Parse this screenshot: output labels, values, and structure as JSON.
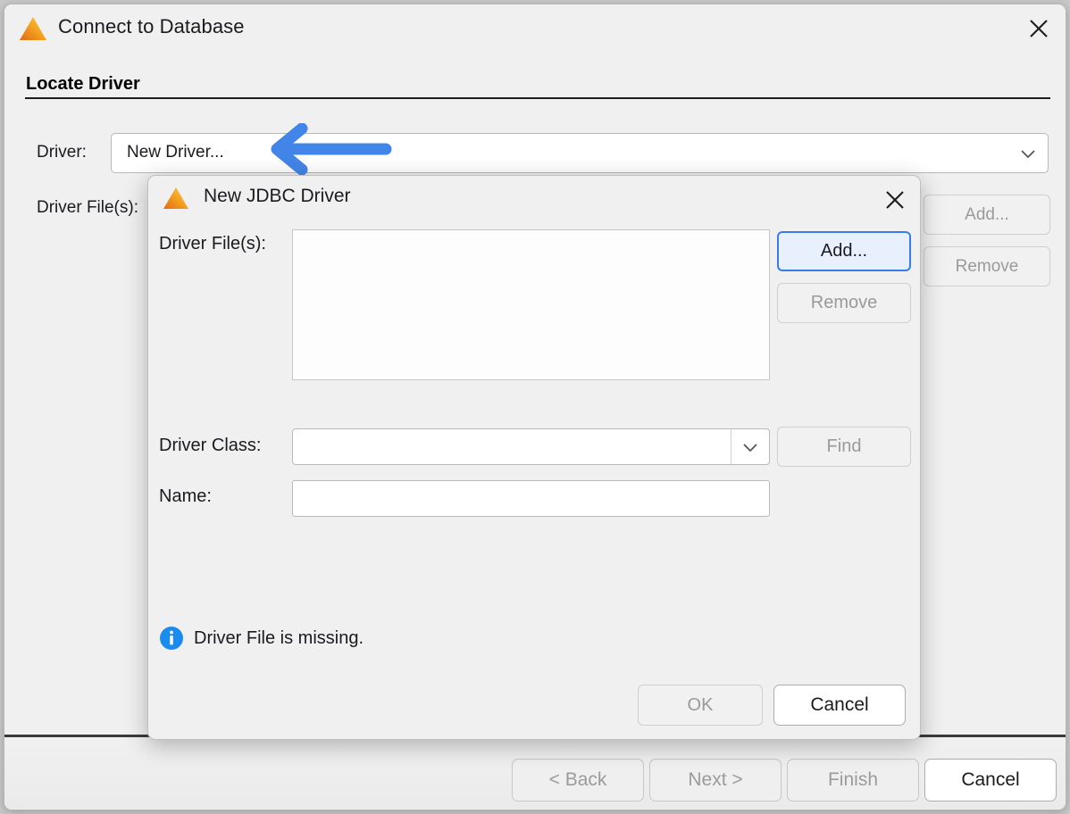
{
  "outer_dialog": {
    "title": "Connect to Database",
    "app_icon": "triangle-logo-icon",
    "close_icon": "close-icon",
    "section_heading": "Locate Driver",
    "driver": {
      "label": "Driver:",
      "value": "New Driver...",
      "dropdown_icon": "chevron-down-icon"
    },
    "driver_files": {
      "label": "Driver File(s):",
      "items": [],
      "add_label": "Add...",
      "remove_label": "Remove"
    },
    "footer": {
      "back_label": "< Back",
      "next_label": "Next >",
      "finish_label": "Finish",
      "cancel_label": "Cancel"
    }
  },
  "annotation": {
    "type": "arrow-left",
    "color": "#4285e8"
  },
  "inner_dialog": {
    "title": "New JDBC Driver",
    "app_icon": "triangle-logo-icon",
    "close_icon": "close-icon",
    "driver_files": {
      "label": "Driver File(s):",
      "items": [],
      "add_label": "Add...",
      "remove_label": "Remove"
    },
    "driver_class": {
      "label": "Driver Class:",
      "value": "",
      "placeholder": "",
      "dropdown_icon": "chevron-down-icon",
      "find_label": "Find"
    },
    "name": {
      "label": "Name:",
      "value": "",
      "placeholder": ""
    },
    "status": {
      "icon": "info-icon",
      "text": "Driver File is missing.",
      "icon_color": "#1a8cf0"
    },
    "footer": {
      "ok_label": "OK",
      "cancel_label": "Cancel"
    }
  },
  "theme": {
    "background": "#f0f0f0",
    "focus_blue": "#3a7bea",
    "focus_fill": "#e8f0fd",
    "disabled_text": "#9a9a9a",
    "logo_left": "#e8761f",
    "logo_right": "#ffc92e"
  }
}
